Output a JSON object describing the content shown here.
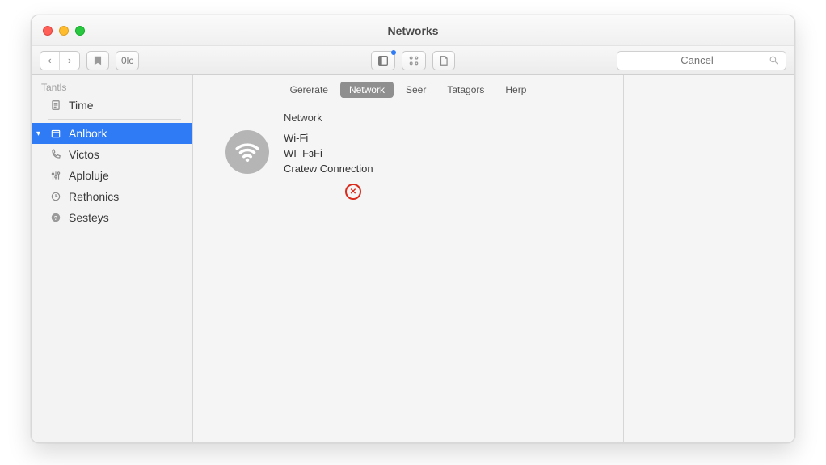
{
  "window": {
    "title": "Networks"
  },
  "toolbar": {
    "back_label": "‹",
    "forward_label": "›",
    "action_label": "",
    "small_button_label": "0lc",
    "search_placeholder": "Cancel"
  },
  "sidebar": {
    "header": "Tantls",
    "items": [
      {
        "label": "Time",
        "icon": "document-icon",
        "selected": false
      },
      {
        "label": "Anlbork",
        "icon": "box-icon",
        "selected": true
      },
      {
        "label": "Victos",
        "icon": "phone-icon",
        "selected": false
      },
      {
        "label": "Aploluje",
        "icon": "equalizer-icon",
        "selected": false
      },
      {
        "label": "Rethonics",
        "icon": "clock-icon",
        "selected": false
      },
      {
        "label": "Sesteys",
        "icon": "question-icon",
        "selected": false
      }
    ]
  },
  "tabs": [
    {
      "label": "Gererate",
      "active": false
    },
    {
      "label": "Network",
      "active": true
    },
    {
      "label": "Seer",
      "active": false
    },
    {
      "label": "Tatagors",
      "active": false
    },
    {
      "label": "Herp",
      "active": false
    }
  ],
  "content": {
    "section_label": "Network",
    "lines": [
      "Wi-Fi",
      "WI–FɜFi",
      "Cratew Connection"
    ]
  }
}
